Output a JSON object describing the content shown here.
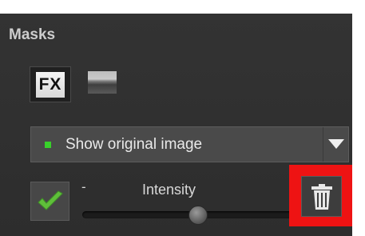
{
  "panel": {
    "title": "Masks"
  },
  "mask_type": {
    "fx_label": "FX",
    "fx_icon": "fx-icon",
    "image_icon": "image-thumbnail-icon"
  },
  "view_dropdown": {
    "selected": "Show original image",
    "indicator_color": "#38d12a",
    "arrow_icon": "triangle-down-icon"
  },
  "apply": {
    "icon": "checkmark-icon",
    "color": "#5fbf3a"
  },
  "intensity": {
    "minus_label": "-",
    "label": "Intensity",
    "value_fraction": 0.5
  },
  "delete": {
    "icon": "trash-icon",
    "highlight_color": "#ee1313"
  }
}
